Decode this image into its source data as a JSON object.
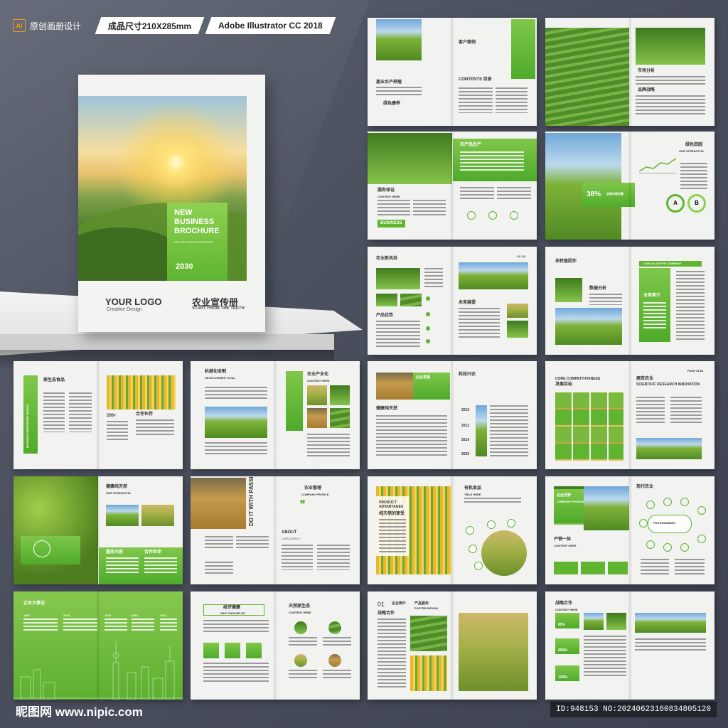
{
  "banner": {
    "ai_badge": "Ai",
    "original": "原创画册设计",
    "size": "成品尺寸210X285mm",
    "software": "Adobe Illustrator CC 2018"
  },
  "cover": {
    "box_title": "NEW BUSINESS BROCHURE",
    "box_sub": "NEW BUSINESS BORCHURE",
    "year": "2030",
    "logo": "YOUR LOGO",
    "logo_sub": "Creative Design",
    "cn_title": "农业宣传册",
    "cn_sub": "START FROM THE TEETH"
  },
  "spreads": {
    "s1": {
      "a": "基业水产养殖",
      "b": "绿色康养",
      "c": "CONTENTS 目录",
      "d": "客户案例"
    },
    "s2": {
      "a": "市场分析",
      "b": "品牌战略"
    },
    "s3": {
      "a": "服务保证",
      "b": "CONTENT HERE",
      "c": "BUSINESS",
      "d": "农产品生产"
    },
    "s4": {
      "a": "38%",
      "b": "全球市场份额",
      "c": "绿色田园",
      "d": "OUR STRENGTHS",
      "e": "A",
      "f": "B"
    },
    "s5": {
      "a": "农业新风尚",
      "b": "产品优势",
      "c": "01 / 02",
      "d": "未来展望"
    },
    "s6": {
      "a": "非转基因作",
      "b": "数据分析",
      "c": "OUR VALUE THE COMPANY",
      "d": "业务简介"
    },
    "s7": {
      "a": "BUSINESS BROCHURE DESIGN",
      "b": "原生态食品",
      "c": "200+",
      "d": "合作伙伴"
    },
    "s8": {
      "a": "机械化收割",
      "b": "DEVELOPMENT GOAL",
      "c": "农业产业化",
      "d": "CONTENT HERE"
    },
    "s9": {
      "a": "企业发展",
      "b": "健康纯天然",
      "c": "科技兴农",
      "d": "2010",
      "e": "2012",
      "f": "2019",
      "g": "2025"
    },
    "s10": {
      "a": "CORE COMPETITIVENESS",
      "b": "发展目标",
      "c": "高效农业",
      "d": "SCIENTIFIC RESEARCH INNOVATION",
      "e": "PAGE 01/03"
    },
    "s11": {
      "a": "健康纯天然",
      "b": "OUR STRENGTHS",
      "c": "服务内容",
      "d": "合作伙伴"
    },
    "s12": {
      "a": "DO IT WITH PASSION",
      "b": "农业管理",
      "c": "COMPANY PROFILE",
      "d": "ABOUT",
      "e": "OUR AGENCY"
    },
    "s13": {
      "a": "PRODUCT ADVANTAGES",
      "b": "纯天然的享受",
      "c": "有机食品",
      "d": "TIELE HERE"
    },
    "s14": {
      "a": "企业优势",
      "b": "COMPANY PROFILE",
      "c": "产销一体",
      "d": "CONTENT HERE",
      "e": "现代农业",
      "f": "PROGRAMMING"
    },
    "s15": {
      "a": "企业大事记",
      "b": "1997",
      "c": "2010",
      "d": "2015",
      "e": "2018",
      "f": "2022"
    },
    "s16": {
      "a": "经济健康",
      "b": "WHY CHOOSE US",
      "c": "天然原生态",
      "d": "CONTENT HERE"
    },
    "s17": {
      "a": "01",
      "b": "企业简介",
      "c": "产品服务",
      "d": "POSTER DESIGN",
      "e": "战略合作"
    },
    "s18": {
      "a": "战略合作",
      "b": "CONTENT HERE",
      "c": "85%",
      "d": "8500+",
      "e": "1200+"
    }
  },
  "footer": {
    "site": "昵图网 www.nipic.com",
    "id": "ID:948153 NO:20240623160834805120"
  },
  "colors": {
    "accent": "#5fb530",
    "accent_light": "#8ed152",
    "bg": "#4d5261"
  }
}
